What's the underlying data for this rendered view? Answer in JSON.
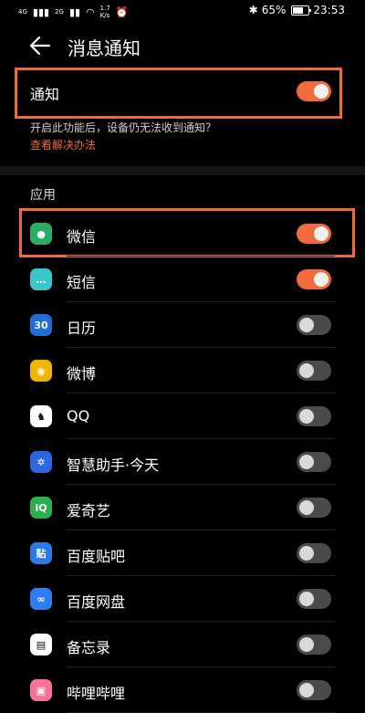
{
  "status_bar": {
    "signal_1": "4G",
    "signal_2": "2G",
    "speed_value": "1.7",
    "speed_unit": "K/s",
    "battery": "65%",
    "battery_level": 0.65,
    "time": "23:53"
  },
  "header": {
    "title": "消息通知"
  },
  "notifications": {
    "label": "通知",
    "enabled": true,
    "hint": "开启此功能后，设备仍无法收到通知？",
    "hint_link": "查看解决办法"
  },
  "apps_section": {
    "title": "应用"
  },
  "apps": [
    {
      "name": "微信",
      "enabled": true,
      "icon": "wechat-icon",
      "color": "#2aae67",
      "glyph": "●"
    },
    {
      "name": "短信",
      "enabled": true,
      "icon": "sms-icon",
      "color": "#39c6c9",
      "glyph": "…"
    },
    {
      "name": "日历",
      "enabled": false,
      "icon": "calendar-icon",
      "color": "#1f6fd6",
      "glyph": "30"
    },
    {
      "name": "微博",
      "enabled": false,
      "icon": "weibo-icon",
      "color": "#f3b400",
      "glyph": "◉"
    },
    {
      "name": "QQ",
      "enabled": false,
      "icon": "qq-icon",
      "color": "#ffffff",
      "glyph": "♞"
    },
    {
      "name": "智慧助手·今天",
      "enabled": false,
      "icon": "assistant-icon",
      "color": "#2a66e0",
      "glyph": "✲"
    },
    {
      "name": "爱奇艺",
      "enabled": false,
      "icon": "iqiyi-icon",
      "color": "#28b04d",
      "glyph": "iQ"
    },
    {
      "name": "百度贴吧",
      "enabled": false,
      "icon": "tieba-icon",
      "color": "#2c7be5",
      "glyph": "贴"
    },
    {
      "name": "百度网盘",
      "enabled": false,
      "icon": "baidu-netdisk-icon",
      "color": "#2f7cf6",
      "glyph": "∞"
    },
    {
      "name": "备忘录",
      "enabled": false,
      "icon": "memo-icon",
      "color": "#ffffff",
      "glyph": "▤"
    },
    {
      "name": "哔哩哔哩",
      "enabled": false,
      "icon": "bilibili-icon",
      "color": "#fb7299",
      "glyph": "▣"
    }
  ],
  "colors": {
    "accent": "#f26b3a",
    "highlight_box": "#ef6a3a",
    "toggle_off": "#4a4a4a"
  }
}
